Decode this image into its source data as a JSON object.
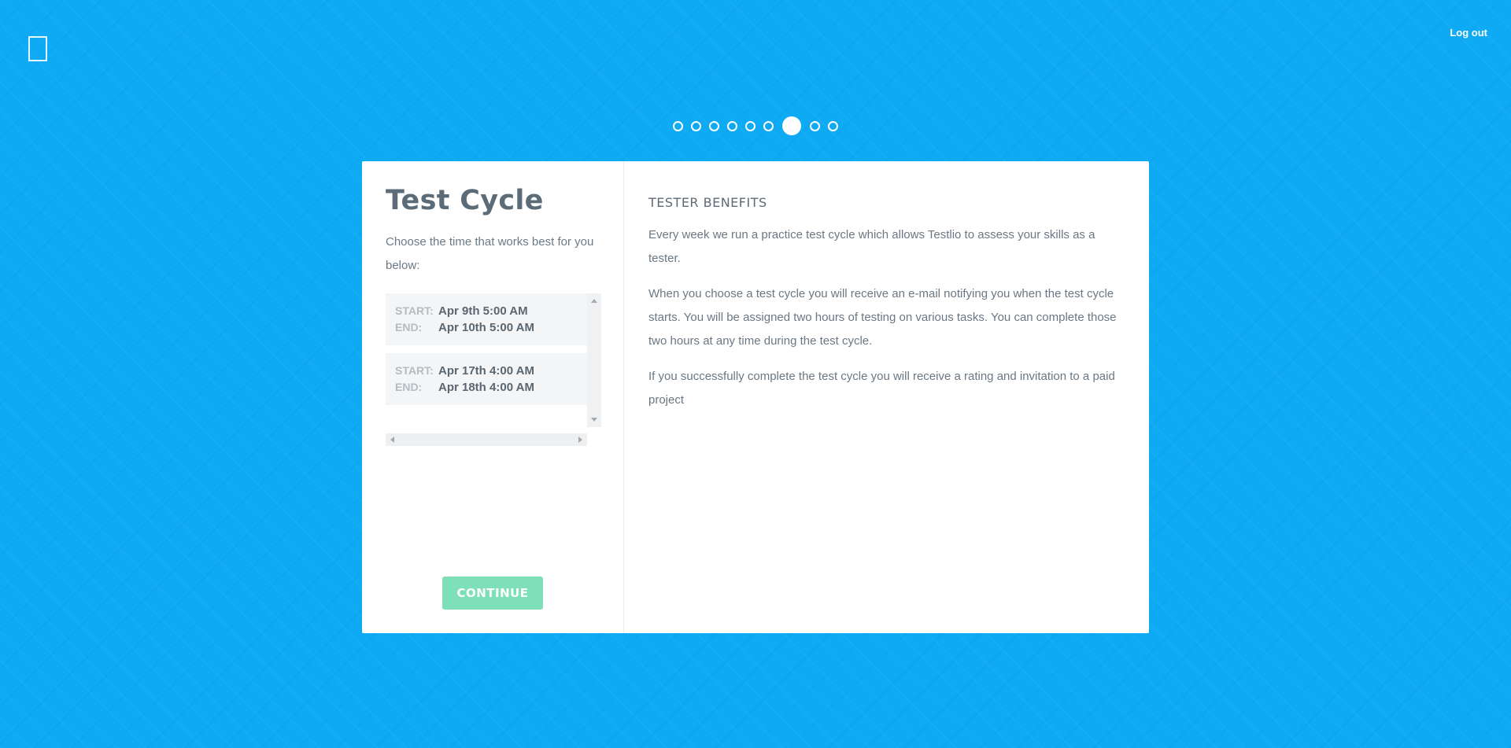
{
  "header": {
    "logout_label": "Log out"
  },
  "progress": {
    "total_steps": 9,
    "current_step": 7
  },
  "left_panel": {
    "title": "Test Cycle",
    "subtitle": "Choose the time that works best for you below:",
    "slots": [
      {
        "start_label": "START:",
        "start": "Apr 9th 5:00 AM",
        "end_label": "END:",
        "end": "Apr 10th 5:00 AM"
      },
      {
        "start_label": "START:",
        "start": "Apr 17th 4:00 AM",
        "end_label": "END:",
        "end": "Apr 18th 4:00 AM"
      }
    ],
    "continue_label": "CONTINUE"
  },
  "right_panel": {
    "heading": "TESTER BENEFITS",
    "paragraphs": [
      "Every week we run a practice test cycle which allows Testlio to assess your skills as a tester.",
      "When you choose a test cycle you will receive an e-mail notifying you when the test cycle starts. You will be assigned two hours of testing on various tasks. You can complete those two hours at any time during the test cycle.",
      "If you successfully complete the test cycle you will receive a rating and invitation to a paid project"
    ]
  },
  "colors": {
    "background": "#0eaaf4",
    "accent_button": "#7ee0b8",
    "text_dark": "#5b6b77"
  }
}
